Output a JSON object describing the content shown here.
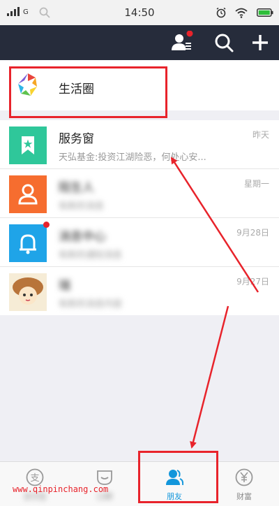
{
  "status": {
    "network": "G",
    "time": "14:50"
  },
  "header": {
    "contacts_icon": "contact-list-icon",
    "search_icon": "search-icon",
    "add_icon": "plus-icon"
  },
  "life_circle": {
    "label": "生活圈"
  },
  "conversations": [
    {
      "title": "服务窗",
      "preview": "天弘基金:投资江湖险恶，何处心安...",
      "time": "昨天",
      "icon": "bookmark-star-icon",
      "color": "#2fc79a"
    },
    {
      "title": "陌生人",
      "preview": "有新的消息",
      "time": "星期一",
      "icon": "person-icon",
      "color": "#f66d2f"
    },
    {
      "title": "消息中心",
      "preview": "有新的通知消息",
      "time": "9月28日",
      "icon": "bell-icon",
      "color": "#1fa4e8"
    },
    {
      "title": "瑞",
      "preview": "有新的消息内容",
      "time": "9月27日",
      "icon": "cartoon-avatar",
      "color": "#f0d9a8"
    }
  ],
  "tabs": [
    {
      "label": "支付宝",
      "icon": "pay-icon"
    },
    {
      "label": "口碑",
      "icon": "koubei-icon"
    },
    {
      "label": "朋友",
      "icon": "friends-icon",
      "active": true
    },
    {
      "label": "财富",
      "icon": "yen-icon"
    }
  ],
  "colors": {
    "active": "#1296db",
    "accent": "#e8232b",
    "header_bg": "#262c3b"
  },
  "watermark": "www.qinpinchang.com"
}
